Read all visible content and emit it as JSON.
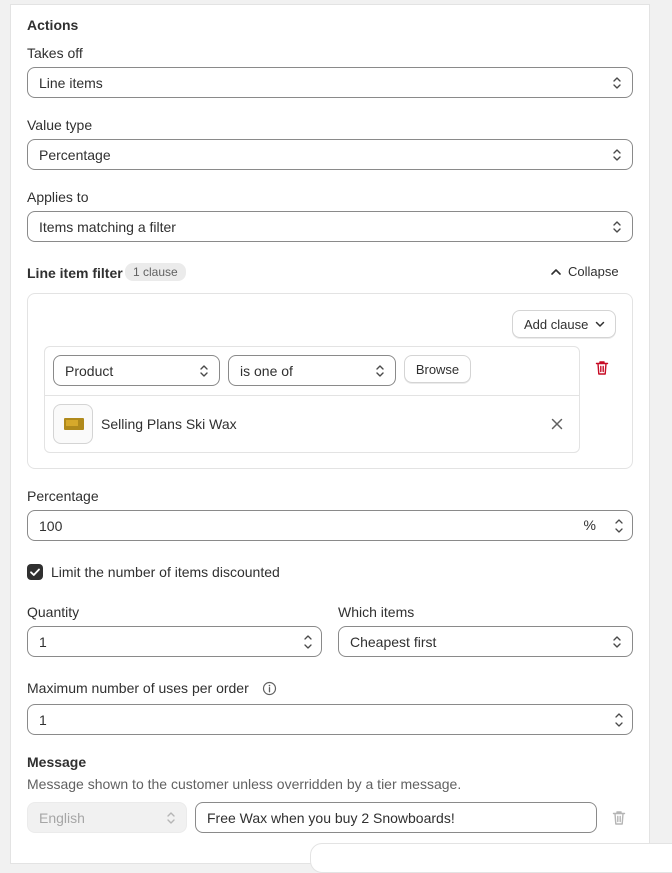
{
  "actions": {
    "heading": "Actions",
    "takes_off": {
      "label": "Takes off",
      "value": "Line items"
    },
    "value_type": {
      "label": "Value type",
      "value": "Percentage"
    },
    "applies_to": {
      "label": "Applies to",
      "value": "Items matching a filter"
    }
  },
  "line_item_filter": {
    "label": "Line item filter",
    "badge": "1 clause",
    "collapse_label": "Collapse",
    "add_clause_label": "Add clause",
    "clause": {
      "field": "Product",
      "operator": "is one of",
      "browse_label": "Browse",
      "product_name": "Selling Plans Ski Wax"
    }
  },
  "percentage": {
    "label": "Percentage",
    "value": "100",
    "suffix": "%"
  },
  "limit": {
    "label": "Limit the number of items discounted",
    "checked": true
  },
  "quantity": {
    "label": "Quantity",
    "value": "1"
  },
  "which_items": {
    "label": "Which items",
    "value": "Cheapest first"
  },
  "max_uses": {
    "label": "Maximum number of uses per order",
    "value": "1"
  },
  "message": {
    "heading": "Message",
    "help": "Message shown to the customer unless overridden by a tier message.",
    "language": "English",
    "value": "Free Wax when you buy 2 Snowboards!"
  },
  "colors": {
    "border": "#8a8a8a",
    "danger": "#c70a24",
    "checkbox": "#303030"
  }
}
